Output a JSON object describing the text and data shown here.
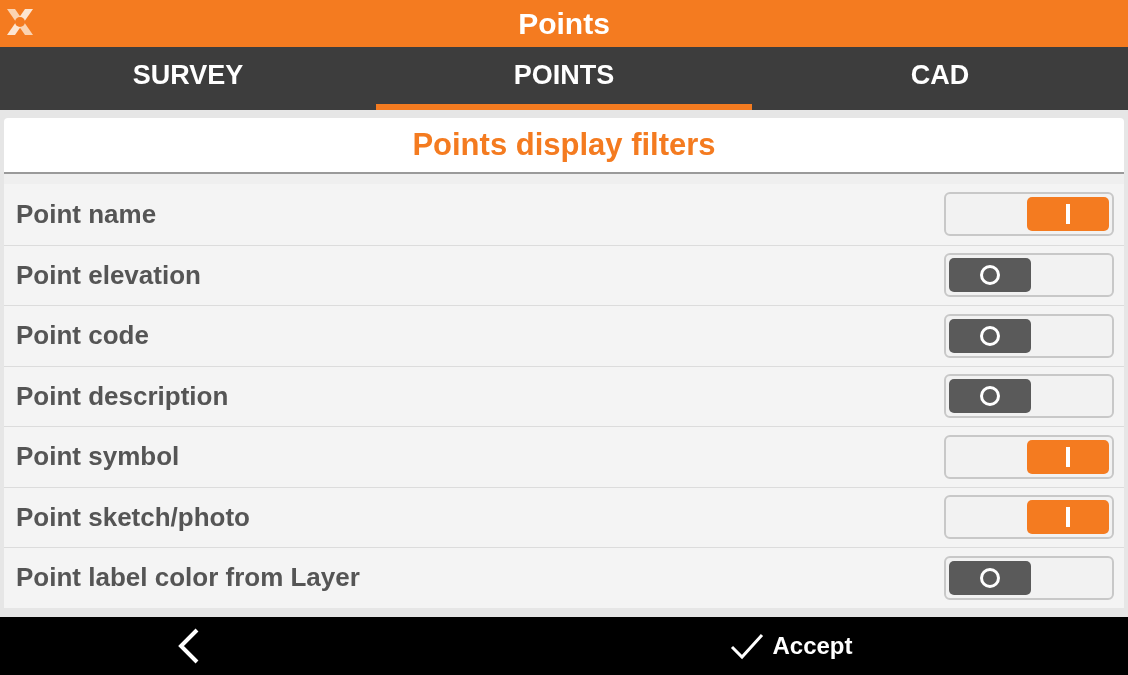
{
  "window": {
    "title": "Points"
  },
  "tabs": [
    {
      "label": "SURVEY",
      "selected": false
    },
    {
      "label": "POINTS",
      "selected": true
    },
    {
      "label": "CAD",
      "selected": false
    }
  ],
  "section_title": "Points display filters",
  "filters": [
    {
      "label": "Point name",
      "on": true
    },
    {
      "label": "Point elevation",
      "on": false
    },
    {
      "label": "Point code",
      "on": false
    },
    {
      "label": "Point description",
      "on": false
    },
    {
      "label": "Point symbol",
      "on": true
    },
    {
      "label": "Point sketch/photo",
      "on": true
    },
    {
      "label": "Point label color from Layer",
      "on": false
    }
  ],
  "footer": {
    "accept": "Accept"
  }
}
